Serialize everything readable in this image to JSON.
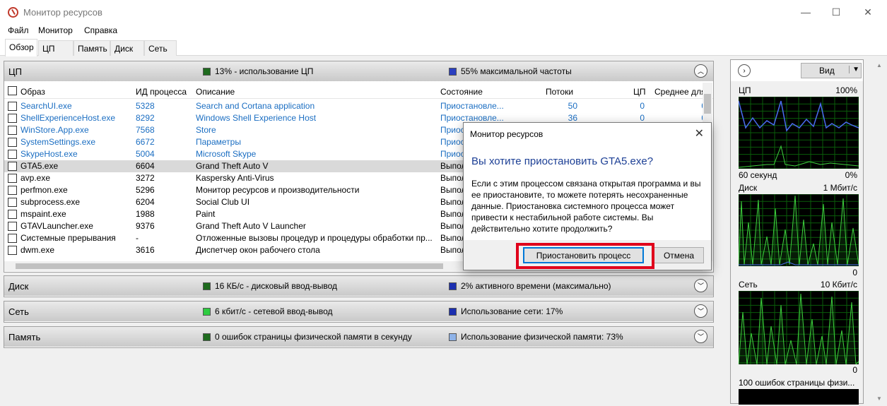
{
  "window": {
    "title": "Монитор ресурсов",
    "min": "—",
    "max": "☐",
    "close": "✕"
  },
  "menu": [
    "Файл",
    "Монитор",
    "Справка"
  ],
  "tabs": [
    "Обзор",
    "ЦП",
    "Память",
    "Диск",
    "Сеть"
  ],
  "cpu": {
    "name": "ЦП",
    "usage": "13% - использование ЦП",
    "freq": "55% максимальной частоты",
    "colors": {
      "green": "#2e7d32",
      "blue": "#1f3fbf"
    },
    "columns": [
      "Образ",
      "ИД процесса",
      "Описание",
      "Состояние",
      "Потоки",
      "ЦП",
      "Среднее для"
    ],
    "rows": [
      {
        "image": "SearchUI.exe",
        "pid": "5328",
        "desc": "Search and Cortana application",
        "state": "Приостановле...",
        "threads": "50",
        "cpu": "0",
        "avg": "0"
      },
      {
        "image": "ShellExperienceHost.exe",
        "pid": "8292",
        "desc": "Windows Shell Experience Host",
        "state": "Приостановле...",
        "threads": "36",
        "cpu": "0",
        "avg": "0"
      },
      {
        "image": "WinStore.App.exe",
        "pid": "7568",
        "desc": "Store",
        "state": "Приост",
        "threads": "",
        "cpu": "",
        "avg": ""
      },
      {
        "image": "SystemSettings.exe",
        "pid": "6672",
        "desc": "Параметры",
        "state": "Приост",
        "threads": "",
        "cpu": "",
        "avg": ""
      },
      {
        "image": "SkypeHost.exe",
        "pid": "5004",
        "desc": "Microsoft Skype",
        "state": "Приост",
        "threads": "",
        "cpu": "",
        "avg": ""
      },
      {
        "image": "GTA5.exe",
        "pid": "6604",
        "desc": "Grand Theft Auto V",
        "state": "Выпол",
        "threads": "",
        "cpu": "",
        "avg": ""
      },
      {
        "image": "avp.exe",
        "pid": "3272",
        "desc": "Kaspersky Anti-Virus",
        "state": "Выпол",
        "threads": "",
        "cpu": "",
        "avg": ""
      },
      {
        "image": "perfmon.exe",
        "pid": "5296",
        "desc": "Монитор ресурсов и производительности",
        "state": "Выпол",
        "threads": "",
        "cpu": "",
        "avg": ""
      },
      {
        "image": "subprocess.exe",
        "pid": "6204",
        "desc": "Social Club UI",
        "state": "Выпол",
        "threads": "",
        "cpu": "",
        "avg": ""
      },
      {
        "image": "mspaint.exe",
        "pid": "1988",
        "desc": "Paint",
        "state": "Выпол",
        "threads": "",
        "cpu": "",
        "avg": ""
      },
      {
        "image": "GTAVLauncher.exe",
        "pid": "9376",
        "desc": "Grand Theft Auto V Launcher",
        "state": "Выпол",
        "threads": "",
        "cpu": "",
        "avg": ""
      },
      {
        "image": "Системные прерывания",
        "pid": "-",
        "desc": "Отложенные вызовы процедур и процедуры обработки пр...",
        "state": "Выпол",
        "threads": "",
        "cpu": "",
        "avg": ""
      },
      {
        "image": "dwm.exe",
        "pid": "3616",
        "desc": "Диспетчер окон рабочего стола",
        "state": "Выпол",
        "threads": "",
        "cpu": "",
        "avg": ""
      }
    ]
  },
  "disk": {
    "name": "Диск",
    "io": "16 КБ/с - дисковый ввод-вывод",
    "active": "2% активного времени (максимально)"
  },
  "net": {
    "name": "Сеть",
    "io": "6 кбит/с - сетевой ввод-вывод",
    "usage": "Использование сети: 17%"
  },
  "mem": {
    "name": "Память",
    "faults": "0 ошибок страницы физической памяти в секунду",
    "usage": "Использование физической памяти: 73%"
  },
  "right": {
    "view": "Вид",
    "cpu": {
      "label": "ЦП",
      "max": "100%",
      "time": "60 секунд",
      "min": "0%"
    },
    "disk": {
      "label": "Диск",
      "max": "1 Мбит/с",
      "min": "0"
    },
    "net": {
      "label": "Сеть",
      "max": "10 Кбит/с",
      "min": "0"
    },
    "mem": {
      "label": "100 ошибок страницы физи..."
    }
  },
  "dialog": {
    "title": "Монитор ресурсов",
    "heading": "Вы хотите приостановить GTA5.exe?",
    "body": "Если с  этим процессом связана открытая программа и вы ее приостановите, то можете потерять несохраненные данные. Приостановка системного процесса может привести к нестабильной работе системы. Вы действительно хотите продолжить?",
    "confirm": "Приостановить процесс",
    "cancel": "Отмена",
    "close": "✕"
  }
}
